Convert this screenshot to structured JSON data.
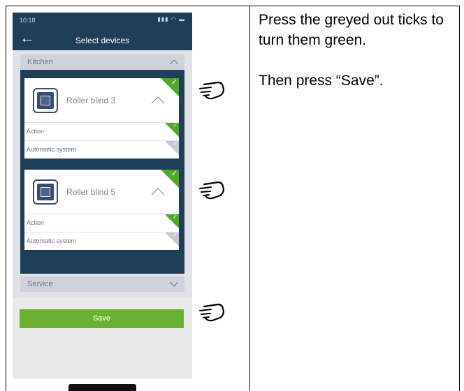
{
  "phone": {
    "status_time": "10:18",
    "status_icons": "▮▮▮ ◠ ▬",
    "back_glyph": "←",
    "nav_title": "Select devices"
  },
  "sections": [
    {
      "label": "Kitchen",
      "expanded": true
    },
    {
      "label": "Service",
      "expanded": false
    }
  ],
  "devices": [
    {
      "name": "Roller blind 3",
      "selected": true,
      "rows": [
        {
          "label": "Action",
          "checked": true
        },
        {
          "label": "Automatic system",
          "checked": false
        }
      ]
    },
    {
      "name": "Roller blind 5",
      "selected": true,
      "rows": [
        {
          "label": "Action",
          "checked": true
        },
        {
          "label": "Automatic system",
          "checked": false
        }
      ]
    }
  ],
  "save_label": "Save",
  "instructions": {
    "line1": "Press the greyed out ticks to turn them green.",
    "line2": "Then press “Save”."
  },
  "icons": [
    "back-arrow-icon",
    "chevron-up-icon",
    "chevron-down-icon",
    "roller-blind-icon",
    "checkmark-icon",
    "pointing-hand-icon"
  ],
  "colors": {
    "header_bg": "#1f3e57",
    "tick_on": "#4faa2c",
    "tick_off": "#c6cad2",
    "save_button": "#6ab132"
  }
}
